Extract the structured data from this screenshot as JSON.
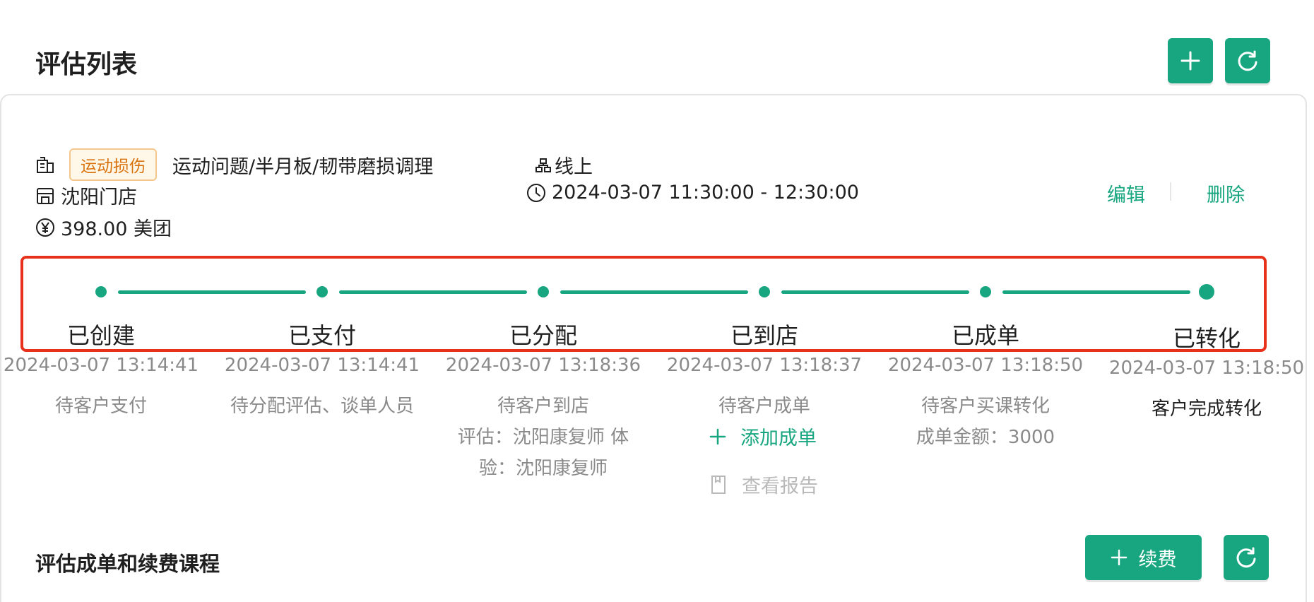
{
  "header": {
    "title": "评估列表"
  },
  "appointment": {
    "tag": "运动损伤",
    "title": "运动问题/半月板/韧带磨损调理",
    "store": "沈阳门店",
    "price": "398.00 美团",
    "mode": "线上",
    "time_range": "2024-03-07 11:30:00 - 12:30:00",
    "edit_label": "编辑",
    "delete_label": "删除"
  },
  "steps": [
    {
      "label": "已创建",
      "time": "2024-03-07 13:14:41",
      "desc": "待客户支付"
    },
    {
      "label": "已支付",
      "time": "2024-03-07 13:14:41",
      "desc": "待分配评估、谈单人员"
    },
    {
      "label": "已分配",
      "time": "2024-03-07 13:18:36",
      "desc": "待客户到店",
      "desc2": "评估：沈阳康复师 体",
      "desc3": "验：沈阳康复师"
    },
    {
      "label": "已到店",
      "time": "2024-03-07 13:18:37",
      "desc": "待客户成单",
      "link1": "添加成单",
      "link2": "查看报告"
    },
    {
      "label": "已成单",
      "time": "2024-03-07 13:18:50",
      "desc": "待客户买课转化",
      "desc2": "成单金额：3000"
    },
    {
      "label": "已转化",
      "time": "2024-03-07 13:18:50",
      "desc": "客户完成转化"
    }
  ],
  "section2": {
    "title": "评估成单和续费课程",
    "renew_label": "续费"
  },
  "colors": {
    "primary": "#17a67f",
    "highlight": "#e8311a",
    "tag_text": "#d9730d"
  }
}
